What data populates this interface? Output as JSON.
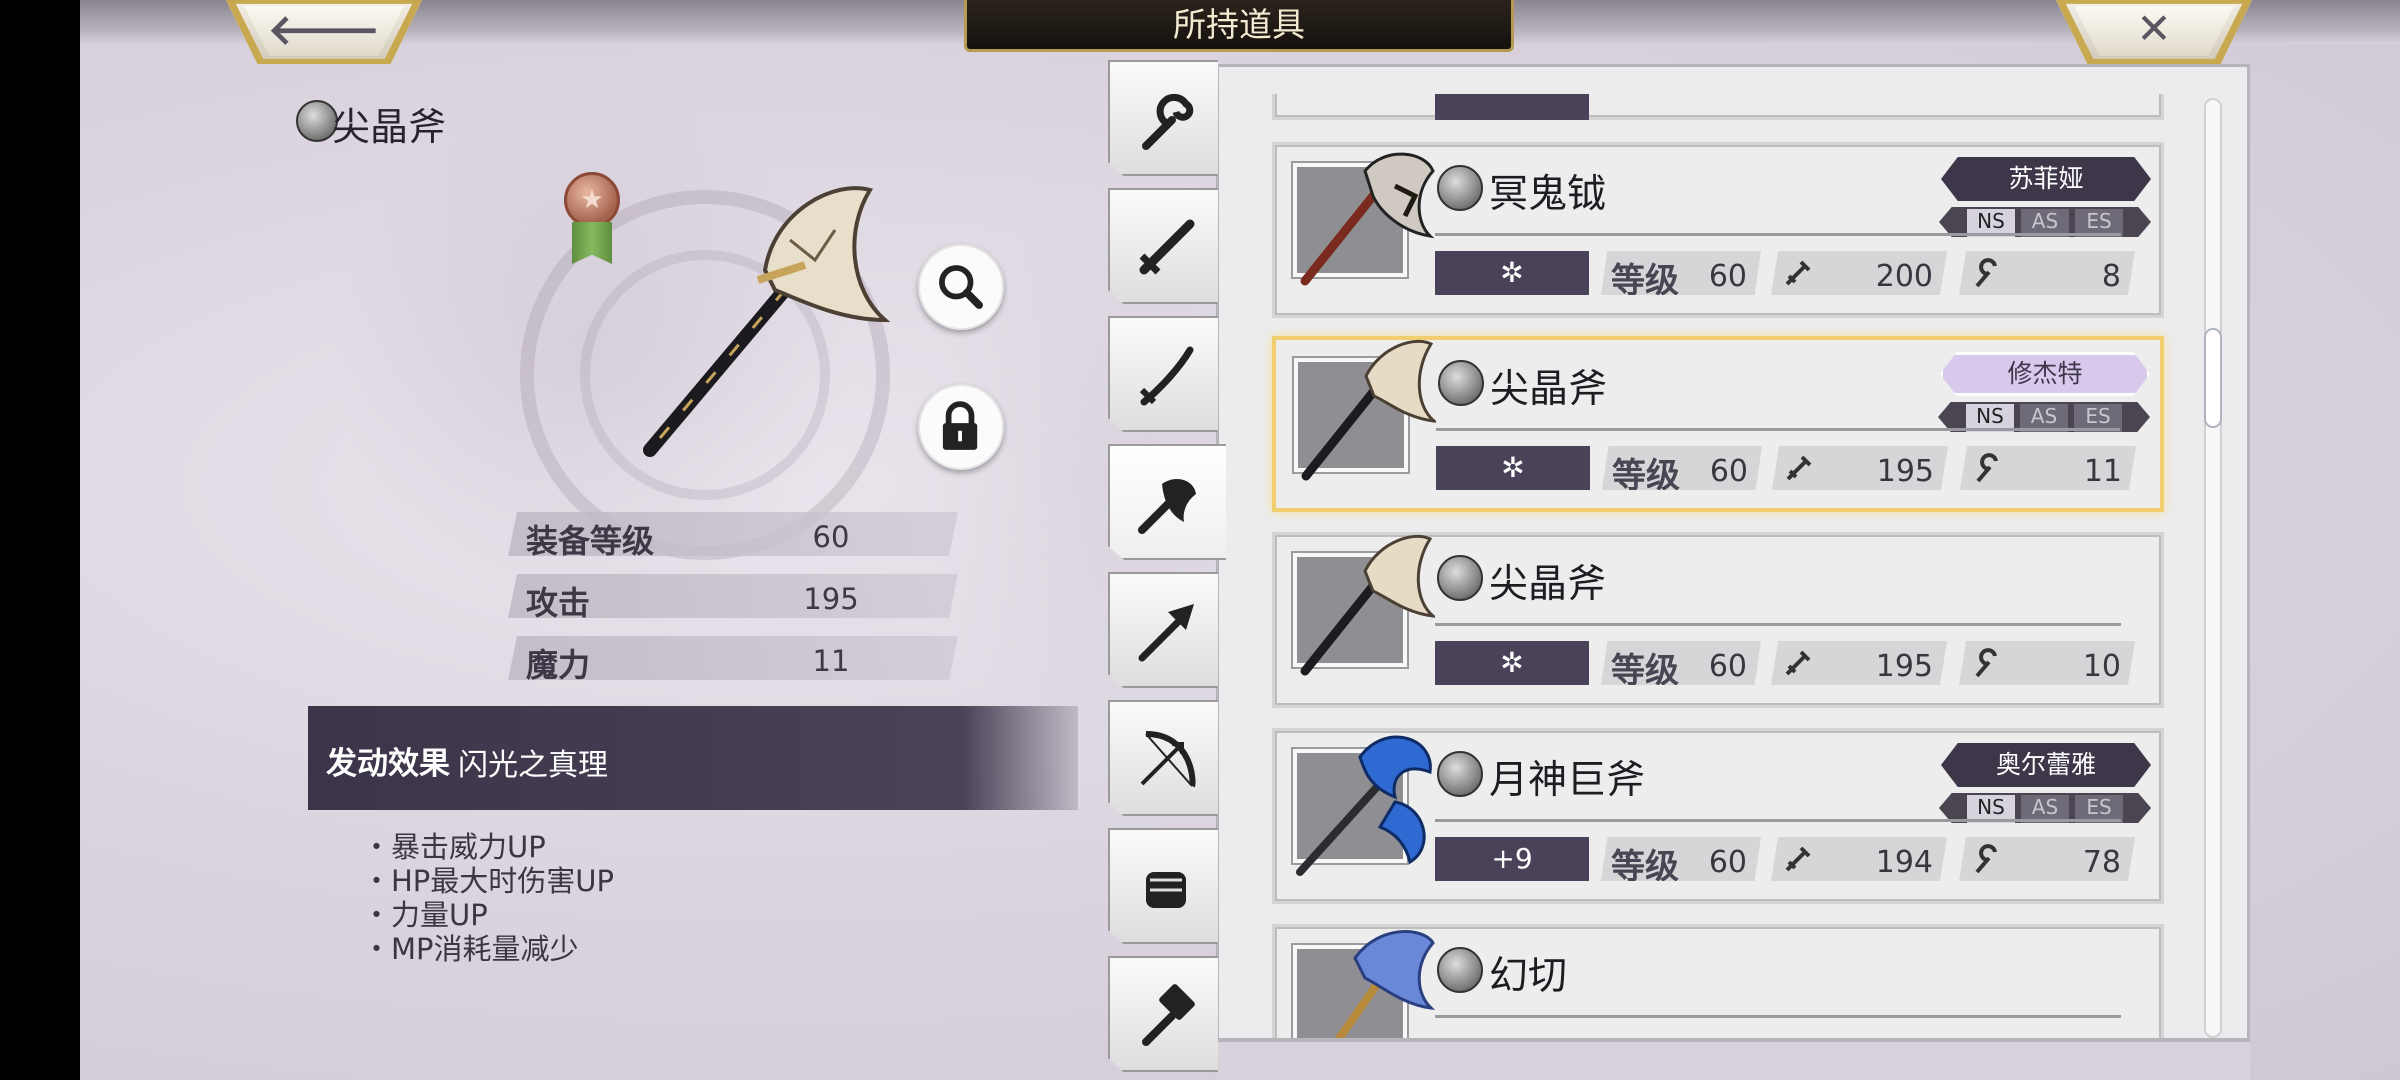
{
  "header": {
    "title": "所持道具",
    "back_glyph": "🡐",
    "close_glyph": "✕"
  },
  "detail": {
    "weapon_name": "尖晶斧",
    "stats": [
      {
        "label": "装备等级",
        "value": "60"
      },
      {
        "label": "攻击",
        "value": "195"
      },
      {
        "label": "魔力",
        "value": "11"
      }
    ],
    "effect_label": "发动效果",
    "effect_name": "闪光之真理",
    "effect_items": [
      "・暴击威力UP",
      "・HP最大时伤害UP",
      "・力量UP",
      "・MP消耗量减少"
    ],
    "medal_glyph": "★"
  },
  "tabs": [
    {
      "icon": "staff-icon",
      "active": false
    },
    {
      "icon": "sword-icon",
      "active": false
    },
    {
      "icon": "katana-icon",
      "active": false
    },
    {
      "icon": "axe-icon",
      "active": true
    },
    {
      "icon": "spear-icon",
      "active": false
    },
    {
      "icon": "bow-icon",
      "active": false
    },
    {
      "icon": "fist-icon",
      "active": false
    },
    {
      "icon": "hammer-icon",
      "active": false
    }
  ],
  "list": {
    "level_label": "等级",
    "items": [
      {
        "name": "冥鬼钺",
        "owner": "苏菲娅",
        "badge": "✲",
        "level": "60",
        "atk": "200",
        "mag": "8",
        "selected": false,
        "color": "#a44a2c"
      },
      {
        "name": "尖晶斧",
        "owner": "修杰特",
        "badge": "✲",
        "level": "60",
        "atk": "195",
        "mag": "11",
        "selected": true,
        "color": "#c9b894"
      },
      {
        "name": "尖晶斧",
        "owner": "",
        "badge": "✲",
        "level": "60",
        "atk": "195",
        "mag": "10",
        "selected": false,
        "color": "#c9b894"
      },
      {
        "name": "月神巨斧",
        "owner": "奥尔蕾雅",
        "badge": "+9",
        "level": "60",
        "atk": "194",
        "mag": "78",
        "selected": false,
        "color": "#2e6ad1"
      },
      {
        "name": "幻切",
        "owner": "",
        "badge": "",
        "level": "",
        "atk": "",
        "mag": "",
        "selected": false,
        "color": "#6a88d8"
      }
    ],
    "tags": [
      "NS",
      "AS",
      "ES"
    ]
  }
}
